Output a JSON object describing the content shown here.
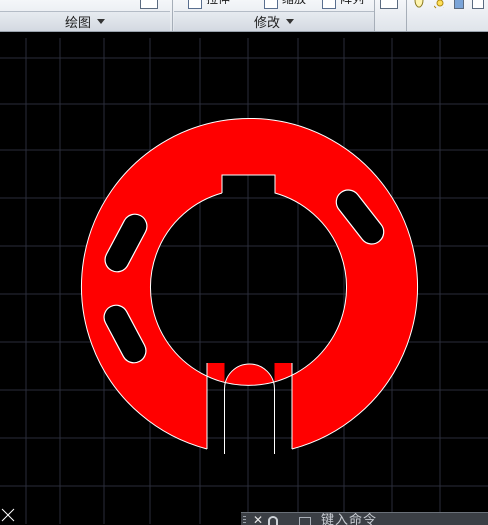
{
  "ribbon": {
    "draw_panel": {
      "label": "绘图"
    },
    "modify_panel": {
      "label": "修改",
      "tools": [
        {
          "label": "拉伸",
          "icon": "stretch-icon"
        },
        {
          "label": "缩放",
          "icon": "scale-icon"
        },
        {
          "label": "阵列",
          "icon": "array-icon"
        }
      ]
    },
    "icons": [
      "table-icon",
      "layer-icon",
      "bulb-icon",
      "sun-icon",
      "layer-state-icon"
    ]
  },
  "drawing": {
    "background": "#000000",
    "fill_color": "#ff0000",
    "outline_color": "#ffffff",
    "grid_color": "#2a2d3a"
  },
  "command_line": {
    "prompt": "键入命令"
  }
}
